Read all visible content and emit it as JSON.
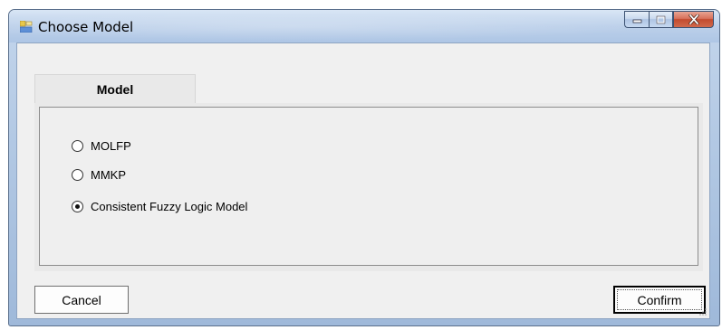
{
  "window": {
    "title": "Choose Model"
  },
  "tabs": [
    {
      "label": "Model",
      "active": true
    }
  ],
  "model_options": [
    {
      "label": "MOLFP",
      "selected": false
    },
    {
      "label": "MMKP",
      "selected": false
    },
    {
      "label": "Consistent Fuzzy Logic Model",
      "selected": true
    }
  ],
  "buttons": {
    "cancel_label": "Cancel",
    "confirm_label": "Confirm"
  },
  "icons": {
    "app": "form-app-icon",
    "minimize": "minimize-icon",
    "maximize": "maximize-icon",
    "close": "close-icon"
  },
  "colors": {
    "close_button": "#c9533a",
    "title_bar": "#bcd0ea"
  }
}
